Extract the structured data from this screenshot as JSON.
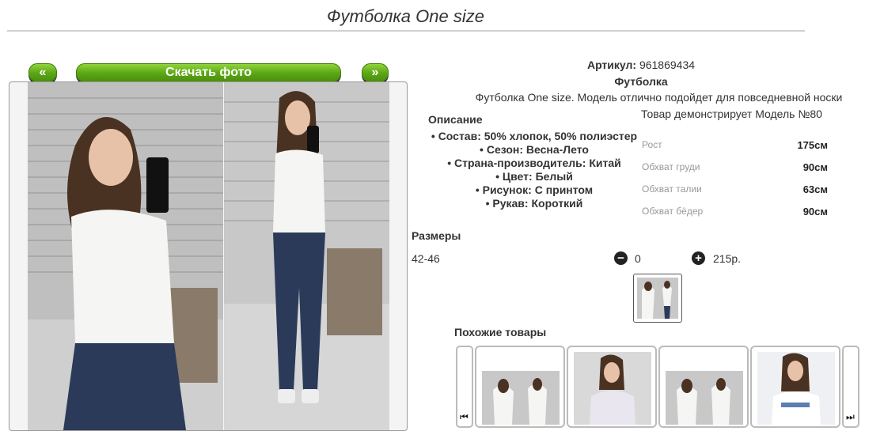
{
  "product": {
    "title": "Футболка One size",
    "article_label": "Артикул:",
    "article_value": "961869434",
    "type": "Футболка",
    "description": "Футболка One size. Модель отлично подойдет для повседневной носки",
    "model_note": "Товар демонстрирует Модель №80"
  },
  "gallery": {
    "prev_label": "«",
    "download_label": "Скачать фото",
    "next_label": "»"
  },
  "description": {
    "heading": "Описание",
    "properties": [
      "Состав: 50% хлопок, 50% полиэстер",
      "Сезон: Весна-Лето",
      "Страна-производитель: Китай",
      "Цвет: Белый",
      "Рисунок: С принтом",
      "Рукав: Короткий"
    ]
  },
  "measurements": [
    {
      "label": "Рост",
      "value": "175см"
    },
    {
      "label": "Обхват груди",
      "value": "90см"
    },
    {
      "label": "Обхват талии",
      "value": "63см"
    },
    {
      "label": "Обхват бёдер",
      "value": "90см"
    }
  ],
  "order": {
    "sizes_heading": "Размеры",
    "size": "42-46",
    "minus_icon": "minus-circle-icon",
    "minus_symbol": "−",
    "quantity": "0",
    "plus_icon": "plus-circle-icon",
    "plus_symbol": "+",
    "price": "215р."
  },
  "similar": {
    "heading": "Похожие товары",
    "prev_icon": "skip-previous-icon",
    "prev_symbol": "⏮",
    "next_icon": "skip-next-icon",
    "next_symbol": "⏭"
  },
  "colors": {
    "accent_green": "#5aa515",
    "text": "#333333",
    "muted": "#999999"
  }
}
